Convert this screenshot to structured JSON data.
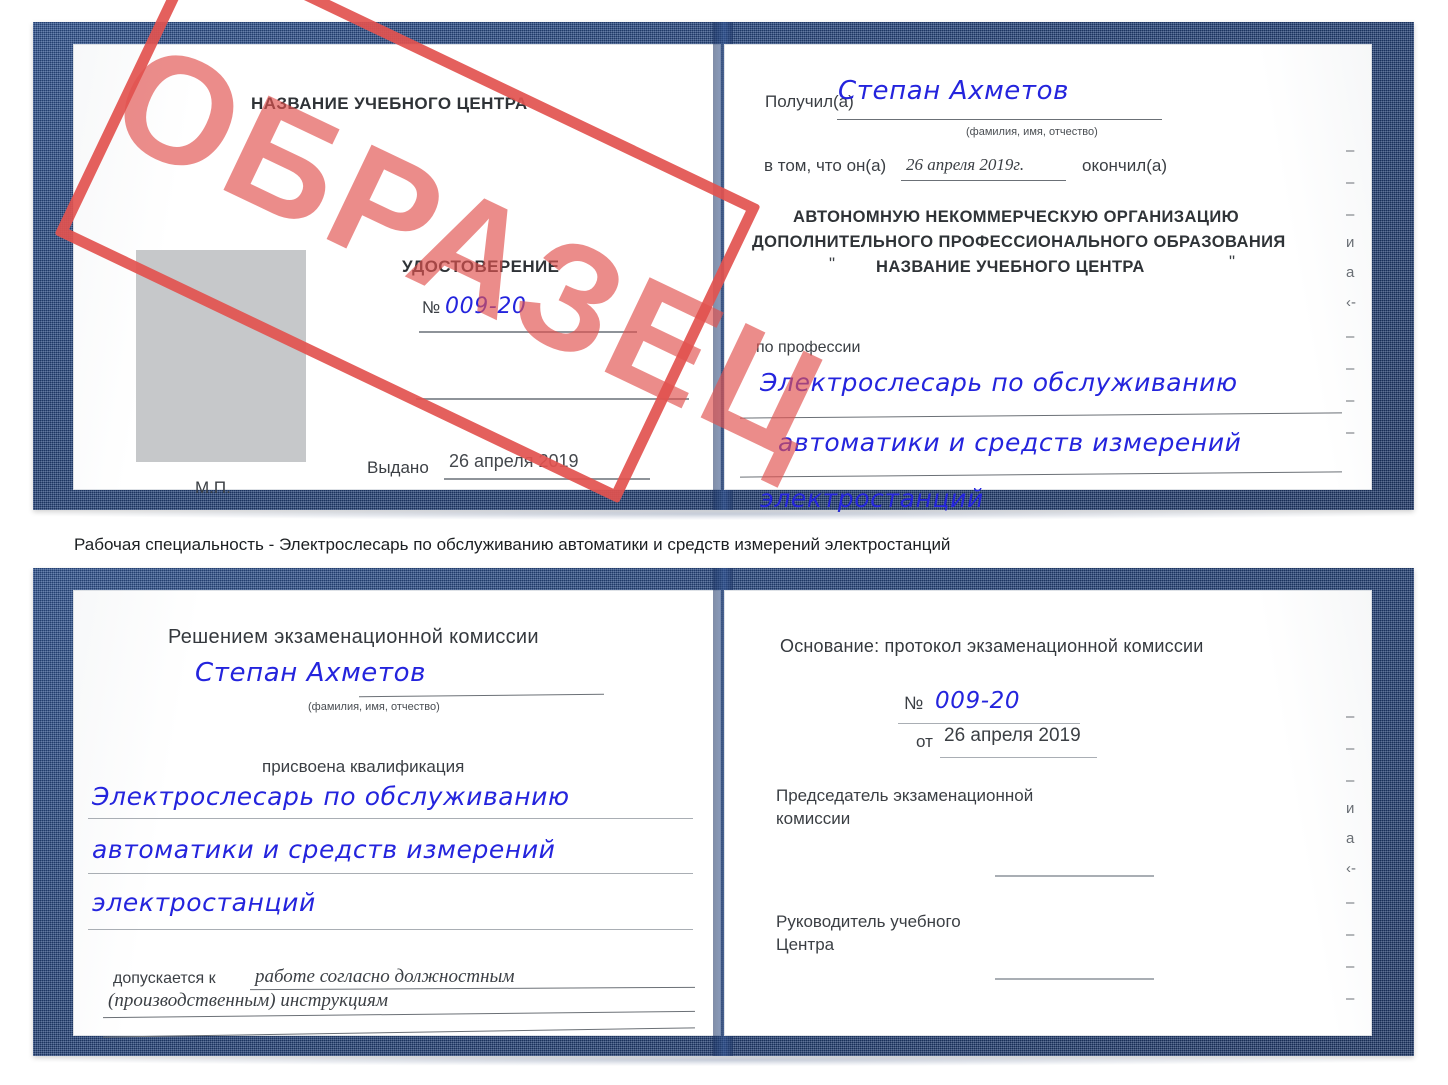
{
  "meta": {
    "stamp_text": "ОБРАЗЕЦ",
    "stamp_color": "#e2524f",
    "handwriting_color": "#2424dd",
    "cover_color": "#234279",
    "page_color": "#ffffff"
  },
  "caption": {
    "text": "Рабочая специальность - Электрослесарь по обслуживанию автоматики и средств измерений электростанций"
  },
  "certificate_one": {
    "left_page": {
      "org_title": "НАЗВАНИЕ УЧЕБНОГО ЦЕНТРА",
      "doc_title": "УДОСТОВЕРЕНИЕ",
      "number_label": "№",
      "number_value": "009-20",
      "issued_label": "Выдано",
      "issued_value": "26 апреля 2019",
      "seal_label": "М.П.",
      "photo_placeholder": "photo-placeholder"
    },
    "right_page": {
      "received_label": "Получил(а)",
      "received_value": "Степан Ахметов",
      "name_hint": "(фамилия, имя, отчество)",
      "in_that_label": "в том, что он(а)",
      "in_that_value": "26 апреля 2019г.",
      "graduated_label": "окончил(а)",
      "org_line_1": "АВТОНОМНУЮ НЕКОММЕРЧЕСКУЮ ОРГАНИЗАЦИЮ",
      "org_line_2": "ДОПОЛНИТЕЛЬНОГО ПРОФЕССИОНАЛЬНОГО ОБРАЗОВАНИЯ",
      "org_quote_open": "\"",
      "org_line_3": "НАЗВАНИЕ УЧЕБНОГО ЦЕНТРА",
      "org_quote_close": "\"",
      "profession_label": "по профессии",
      "profession_line_1": "Электрослесарь по обслуживанию",
      "profession_line_2": "автоматики и средств измерений",
      "profession_line_3": "электростанций"
    },
    "edge_glyphs": [
      "–",
      "–",
      "–",
      "и",
      "а",
      "‹-",
      "–",
      "–",
      "–",
      "–"
    ]
  },
  "certificate_two": {
    "left_page": {
      "commission_title": "Решением экзаменационной комиссии",
      "name_value": "Степан Ахметов",
      "name_hint": "(фамилия, имя, отчество)",
      "qualification_label": "присвоена квалификация",
      "qualification_line_1": "Электрослесарь по обслуживанию",
      "qualification_line_2": "автоматики и средств измерений",
      "qualification_line_3": "электростанций",
      "admitted_label": "допускается к",
      "admitted_value_1": "работе согласно должностным",
      "admitted_value_2": "(производственным) инструкциям"
    },
    "right_page": {
      "basis_label": "Основание: протокол экзаменационной комиссии",
      "protocol_number_label": "№",
      "protocol_number_value": "009-20",
      "protocol_date_label": "от",
      "protocol_date_value": "26 апреля 2019",
      "chairman_line_1": "Председатель экзаменационной",
      "chairman_line_2": "комиссии",
      "head_line_1": "Руководитель учебного",
      "head_line_2": "Центра"
    },
    "edge_glyphs": [
      "–",
      "–",
      "–",
      "и",
      "а",
      "‹-",
      "–",
      "–",
      "–",
      "–"
    ]
  }
}
